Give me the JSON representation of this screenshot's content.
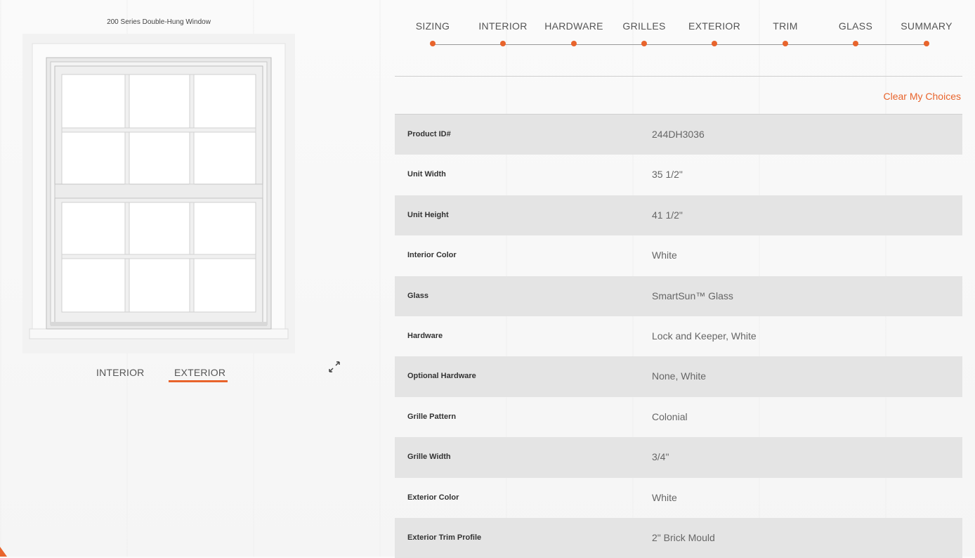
{
  "product": {
    "title": "200 Series Double-Hung Window"
  },
  "view_tabs": [
    {
      "label": "INTERIOR",
      "active": false
    },
    {
      "label": "EXTERIOR",
      "active": true
    }
  ],
  "icons": {
    "expand": "expand-arrows-icon"
  },
  "steps": [
    {
      "label": "SIZING"
    },
    {
      "label": "INTERIOR"
    },
    {
      "label": "HARDWARE"
    },
    {
      "label": "GRILLES"
    },
    {
      "label": "EXTERIOR"
    },
    {
      "label": "TRIM"
    },
    {
      "label": "GLASS"
    },
    {
      "label": "SUMMARY"
    }
  ],
  "clear_choices_label": "Clear My Choices",
  "specs": [
    {
      "label": "Product ID#",
      "value": "244DH3036"
    },
    {
      "label": "Unit Width",
      "value": "35 1/2\""
    },
    {
      "label": "Unit Height",
      "value": "41 1/2\""
    },
    {
      "label": "Interior Color",
      "value": "White"
    },
    {
      "label": "Glass",
      "value": "SmartSun™ Glass"
    },
    {
      "label": "Hardware",
      "value": "Lock and Keeper, White"
    },
    {
      "label": "Optional Hardware",
      "value": "None, White"
    },
    {
      "label": "Grille Pattern",
      "value": "Colonial"
    },
    {
      "label": "Grille Width",
      "value": "3/4\""
    },
    {
      "label": "Exterior Color",
      "value": "White"
    },
    {
      "label": "Exterior Trim Profile",
      "value": "2\" Brick Mould"
    }
  ],
  "colors": {
    "accent": "#e8642c",
    "row_shade": "#e4e4e4"
  }
}
